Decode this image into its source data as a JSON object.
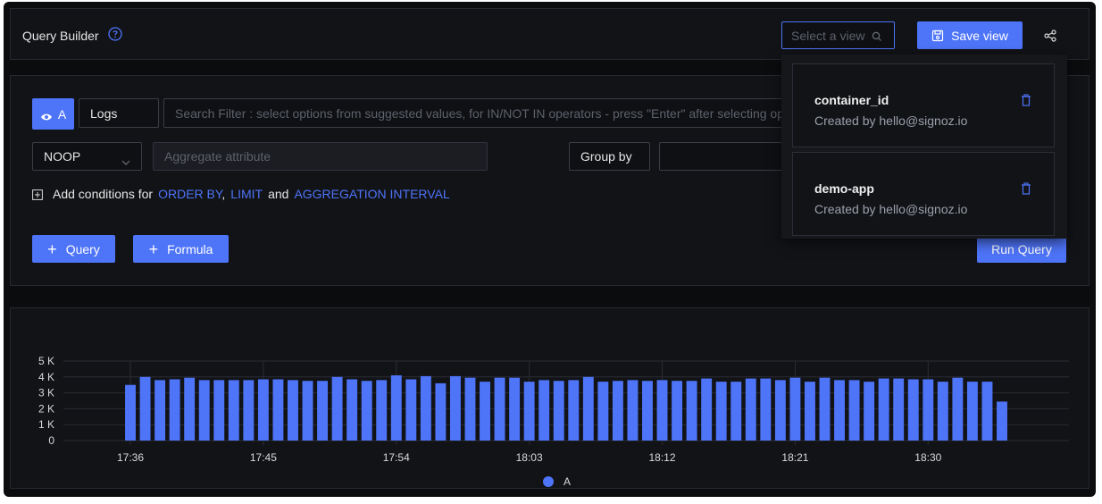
{
  "header": {
    "title": "Query Builder",
    "help_icon": "question-circle-icon",
    "select_view_placeholder": "Select a view",
    "save_view_label": "Save view",
    "share_icon": "share-icon"
  },
  "query": {
    "query_name": "A",
    "data_source": "Logs",
    "search_placeholder": "Search Filter : select options from suggested values, for IN/NOT IN operators - press \"Enter\" after selecting options",
    "aggregate_operator": "NOOP",
    "aggregate_attribute_placeholder": "Aggregate attribute",
    "group_by_label": "Group by",
    "add_conditions_prefix": "Add conditions for",
    "order_by_link": "ORDER BY",
    "limit_link": "LIMIT",
    "and_text": "and",
    "aggregation_interval_link": "AGGREGATION INTERVAL",
    "add_query_label": "Query",
    "add_formula_label": "Formula",
    "run_query_label": "Run Query"
  },
  "saved_views": [
    {
      "name": "container_id",
      "creator": "Created by hello@signoz.io"
    },
    {
      "name": "demo-app",
      "creator": "Created by hello@signoz.io"
    }
  ],
  "colors": {
    "accent": "#4e74f8",
    "bar": "#4e74f8",
    "background": "#0b0c0e",
    "panel": "#121317"
  },
  "chart_data": {
    "type": "bar",
    "x_tick_labels": [
      "17:36",
      "17:45",
      "17:54",
      "18:03",
      "18:12",
      "18:21",
      "18:30"
    ],
    "y_tick_labels": [
      "0",
      "1 K",
      "2 K",
      "3 K",
      "4 K",
      "5 K"
    ],
    "ylim": [
      0,
      5000
    ],
    "grid": true,
    "legend_position": "bottom-center",
    "series": [
      {
        "name": "A",
        "color": "#4e74f8",
        "values": [
          3500,
          4000,
          3800,
          3850,
          3950,
          3800,
          3800,
          3800,
          3800,
          3850,
          3850,
          3800,
          3750,
          3750,
          4000,
          3850,
          3750,
          3800,
          4100,
          3850,
          4050,
          3600,
          4050,
          3950,
          3700,
          3950,
          3950,
          3700,
          3800,
          3750,
          3800,
          4000,
          3700,
          3750,
          3800,
          3750,
          3800,
          3750,
          3750,
          3900,
          3700,
          3700,
          3900,
          3900,
          3800,
          3950,
          3700,
          3950,
          3800,
          3800,
          3700,
          3900,
          3900,
          3850,
          3850,
          3700,
          3950,
          3700,
          3700,
          2450
        ]
      }
    ]
  }
}
